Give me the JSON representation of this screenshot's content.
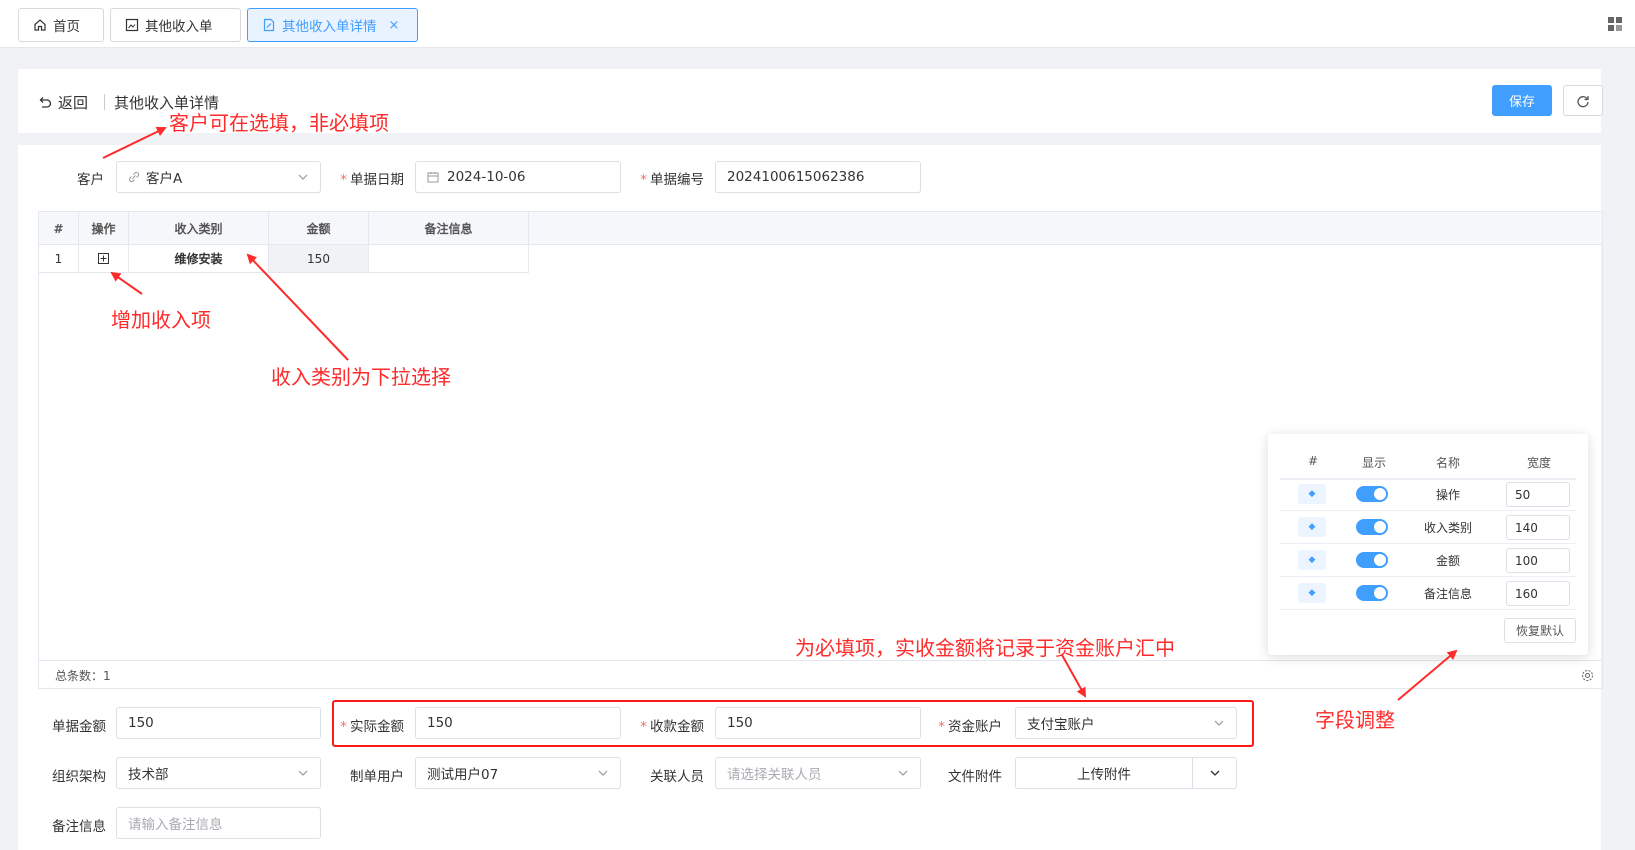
{
  "tabs": [
    {
      "label": "首页",
      "icon": "home-icon"
    },
    {
      "label": "其他收入单",
      "icon": "image-doc-icon"
    },
    {
      "label": "其他收入单详情",
      "icon": "edit-doc-icon",
      "active": true,
      "close": "×"
    }
  ],
  "header": {
    "back_label": "返回",
    "title": "其他收入单详情",
    "save_label": "保存"
  },
  "form_top": {
    "customer_label": "客户",
    "customer_value": "客户A",
    "date_label": "单据日期",
    "date_value": "2024-10-06",
    "number_label": "单据编号",
    "number_value": "2024100615062386"
  },
  "table": {
    "columns": [
      "#",
      "操作",
      "收入类别",
      "金额",
      "备注信息"
    ],
    "rows": [
      {
        "index": "1",
        "action_icon": "plus-square-icon",
        "category": "维修安装",
        "amount": "150",
        "remark": ""
      }
    ],
    "footer": "总条数：1"
  },
  "column_settings": {
    "headers": [
      "#",
      "显示",
      "名称",
      "宽度"
    ],
    "rows": [
      {
        "name": "操作",
        "width": "50",
        "visible": true
      },
      {
        "name": "收入类别",
        "width": "140",
        "visible": true
      },
      {
        "name": "金额",
        "width": "100",
        "visible": true
      },
      {
        "name": "备注信息",
        "width": "160",
        "visible": true
      }
    ],
    "reset_label": "恢复默认"
  },
  "form_bottom": {
    "doc_amount_label": "单据金额",
    "doc_amount_value": "150",
    "actual_amount_label": "实际金额",
    "actual_amount_value": "150",
    "received_amount_label": "收款金额",
    "received_amount_value": "150",
    "account_label": "资金账户",
    "account_value": "支付宝账户",
    "org_label": "组织架构",
    "org_value": "技术部",
    "creator_label": "制单用户",
    "creator_value": "测试用户07",
    "related_label": "关联人员",
    "related_placeholder": "请选择关联人员",
    "attachment_label": "文件附件",
    "attachment_button": "上传附件",
    "remark_label": "备注信息",
    "remark_placeholder": "请输入备注信息"
  },
  "annotations": {
    "customer_note": "客户可在选填，非必填项",
    "add_item_note": "增加收入项",
    "category_note": "收入类别为下拉选择",
    "required_note": "为必填项，实收金额将记录于资金账户汇中",
    "field_adjust_note": "字段调整"
  },
  "colors": {
    "accent": "#409eff",
    "annotation": "#ff2a2a",
    "required": "#f56c6c"
  }
}
